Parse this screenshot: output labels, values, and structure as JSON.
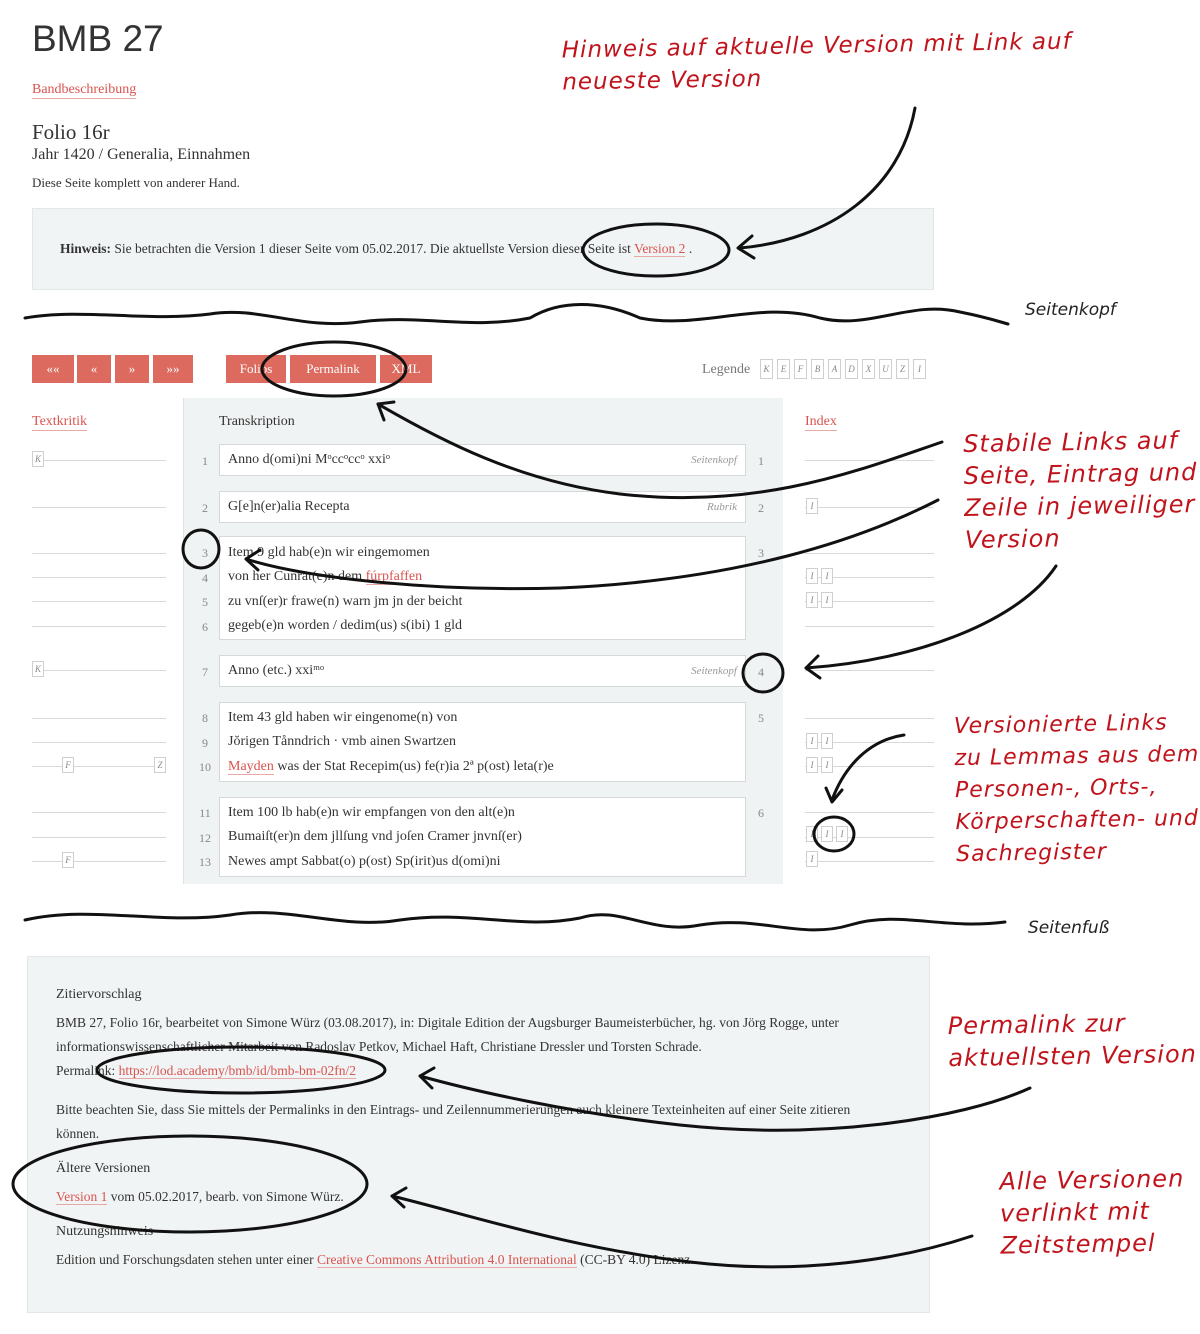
{
  "page": {
    "title": "BMB 27",
    "band_link": "Bandbeschreibung",
    "folio": "Folio 16r",
    "jahr": "Jahr 1420 / Generalia, Einnahmen",
    "hand_note": "Diese Seite komplett von anderer Hand."
  },
  "notice": {
    "label": "Hinweis:",
    "text": "Sie betrachten die Version 1 dieser Seite vom 05.02.2017. Die aktuellste Version dieser Seite ist",
    "link": "Version 2",
    "end": "."
  },
  "nav": {
    "first": "««",
    "prev": "«",
    "next": "»",
    "last": "»»",
    "folios": "Folios",
    "permalink": "Permalink",
    "xml": "XML",
    "legend_label": "Legende",
    "legend_items": [
      "K",
      "E",
      "F",
      "B",
      "A",
      "D",
      "X",
      "U",
      "Z",
      "I"
    ]
  },
  "columns": {
    "textkritik": "Textkritik",
    "transkription": "Transkription",
    "index": "Index"
  },
  "entries": [
    {
      "entry_no": "1",
      "tag": "Seitenkopf",
      "lines": [
        {
          "no": "1",
          "text": "Anno d(omi)ni Mᵒccᵒccᵒ xxiᵒ"
        }
      ]
    },
    {
      "entry_no": "2",
      "tag": "Rubrik",
      "lines": [
        {
          "no": "2",
          "text": "G[e]n(er)alia Recepta"
        }
      ]
    },
    {
      "entry_no": "3",
      "tag": "",
      "lines": [
        {
          "no": "3",
          "text": "Item 9 gld hab(e)n wir eingemomen"
        },
        {
          "no": "4",
          "text": "von her Cunrat(e)n dem ",
          "link": "fúrpfaffen"
        },
        {
          "no": "5",
          "text": "zu vnſ(er)r frawe(n) warn jm jn der beicht"
        },
        {
          "no": "6",
          "text": "gegeb(e)n worden / dedim(us) s(ibi) 1 gld"
        }
      ]
    },
    {
      "entry_no": "4",
      "tag": "Seitenkopf",
      "lines": [
        {
          "no": "7",
          "text": "Anno (etc.) xxiᵐᵒ"
        }
      ]
    },
    {
      "entry_no": "5",
      "tag": "",
      "lines": [
        {
          "no": "8",
          "text": "Item 43 gld haben wir eingenome(n) von"
        },
        {
          "no": "9",
          "text": "Jŏrigen Tånndrich · vmb ainen Swartzen"
        },
        {
          "no": "10",
          "link": "Mayden",
          "text": " was der Stat Recepim(us) fe(r)ia 2ª p(ost) leta(r)e"
        }
      ]
    },
    {
      "entry_no": "6",
      "tag": "",
      "lines": [
        {
          "no": "11",
          "text": "Item 100 lb hab(e)n wir empfangen von den alt(e)n"
        },
        {
          "no": "12",
          "text": "Bumaiſt(er)n dem jllſung vnd joſen Cramer jnvnſ(er)"
        },
        {
          "no": "13",
          "text": "Newes ampt Sabbat(o) p(ost) Sp(irit)us d(omi)ni"
        }
      ]
    }
  ],
  "markers": {
    "k": "K",
    "f": "F",
    "z": "Z",
    "i": "I"
  },
  "footer": {
    "zitier_heading": "Zitiervorschlag",
    "zitier_text_1": "BMB 27, Folio 16r, bearbeitet von Simone Würz (03.08.2017), in: Digitale Edition der Augsburger Baumeisterbücher, hg. von Jörg Rogge, unter",
    "zitier_text_2": "informationswissenschaftlicher Mitarbeit von Radoslav Petkov, Michael Haft, Christiane Dressler und Torsten Schrade.",
    "permalink_label": "Permalink:",
    "permalink_url": "https://lod.academy/bmb/id/bmb-bm-02fn/2",
    "hint_1": "Bitte beachten Sie, dass Sie mittels der Permalinks in den Eintrags- und Zeilennummerierungen auch kleinere Texteinheiten auf einer Seite zitieren",
    "hint_2": "können.",
    "older_heading": "Ältere Versionen",
    "older_link": "Version 1",
    "older_text": " vom 05.02.2017, bearb. von Simone Würz.",
    "usage_heading": "Nutzungshinweis",
    "usage_text_1": "Edition und Forschungsdaten stehen unter einer ",
    "usage_link": "Creative Commons Attribution 4.0 International",
    "usage_text_2": " (CC-BY 4.0) Lizenz."
  },
  "annotations": {
    "hinweis": [
      "Hinweis auf aktuelle Version mit Link auf",
      "neueste Version"
    ],
    "seitenkopf": "Seitenkopf",
    "stabile": [
      "Stabile Links auf",
      "Seite, Eintrag und",
      "Zeile in jeweiliger",
      "Version"
    ],
    "versionierte": [
      "Versionierte Links",
      "zu Lemmas aus dem",
      "Personen-, Orts-,",
      "Körperschaften- und",
      "Sachregister"
    ],
    "seitenfuss": "Seitenfuß",
    "permalink_note": [
      "Permalink zur",
      "aktuellsten Version"
    ],
    "alle": [
      "Alle Versionen",
      "verlinkt mit",
      "Zeitstempel"
    ]
  },
  "colors": {
    "accent": "#dc6a5e",
    "link": "#d9534f",
    "annotation": "#c0131b",
    "panel": "#f1f4f4"
  }
}
